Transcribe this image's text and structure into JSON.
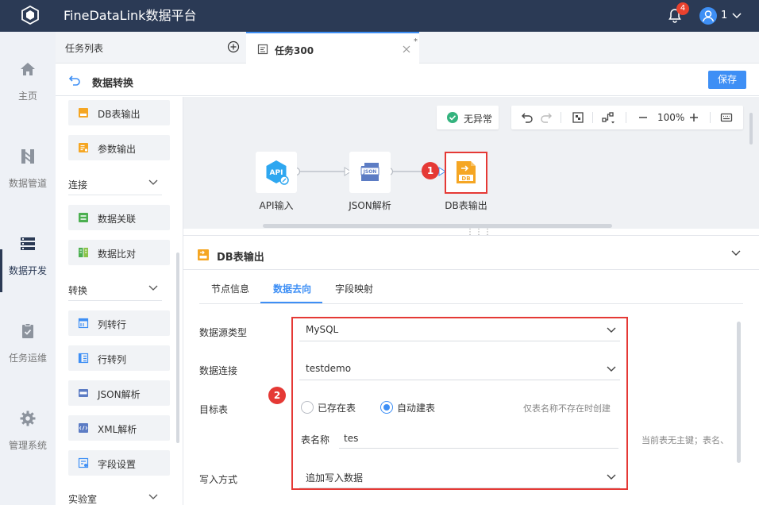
{
  "app": {
    "title": "FineDataLink数据平台",
    "notification_count": "4",
    "user_name": "1"
  },
  "nav": {
    "items": [
      {
        "label": "主页",
        "icon": "home-icon"
      },
      {
        "label": "数据管道",
        "icon": "pipeline-icon"
      },
      {
        "label": "数据开发",
        "icon": "data-dev-icon",
        "active": true
      },
      {
        "label": "任务运维",
        "icon": "task-ops-icon"
      },
      {
        "label": "管理系统",
        "icon": "gear-icon"
      }
    ]
  },
  "tabs": {
    "list_label": "任务列表",
    "active_label": "任务300",
    "modified_mark": "*"
  },
  "header": {
    "title": "数据转换",
    "save_label": "保存"
  },
  "palette": {
    "output_items": [
      {
        "label": "DB表输出"
      },
      {
        "label": "参数输出"
      }
    ],
    "sections": [
      {
        "label": "连接",
        "items": [
          {
            "label": "数据关联"
          },
          {
            "label": "数据比对"
          }
        ]
      },
      {
        "label": "转换",
        "items": [
          {
            "label": "列转行"
          },
          {
            "label": "行转列"
          },
          {
            "label": "JSON解析"
          },
          {
            "label": "XML解析"
          },
          {
            "label": "字段设置"
          }
        ]
      },
      {
        "label": "实验室"
      }
    ]
  },
  "canvas": {
    "status_label": "无异常",
    "zoom": "100%",
    "nodes": [
      {
        "label": "API输入",
        "glyph": "API"
      },
      {
        "label": "JSON解析",
        "glyph": "JSON"
      },
      {
        "label": "DB表输出",
        "glyph": "DB"
      }
    ],
    "marker_1": "1",
    "drag_handle": "⋮⋮⋮"
  },
  "properties": {
    "title": "DB表输出",
    "tabs": [
      "节点信息",
      "数据去向",
      "字段映射"
    ],
    "active_tab": "数据去向",
    "marker_2": "2",
    "fields": {
      "source_type": {
        "label": "数据源类型",
        "value": "MySQL"
      },
      "connection": {
        "label": "数据连接",
        "value": "testdemo"
      },
      "target_table": {
        "label": "目标表",
        "options": [
          "已存在表",
          "自动建表"
        ],
        "selected": "自动建表",
        "hint": "仅表名称不存在时创建"
      },
      "table_name": {
        "label": "表名称",
        "value": "tes"
      },
      "pk_note": "当前表无主键；表名、",
      "write_mode": {
        "label": "写入方式",
        "value": "追加写入数据"
      }
    }
  },
  "colors": {
    "topbar": "#2b3a55",
    "accent": "#3e8ff5",
    "highlight": "#e53935",
    "db_node": "#f5a623",
    "node_blue": "#2ea7f0"
  }
}
